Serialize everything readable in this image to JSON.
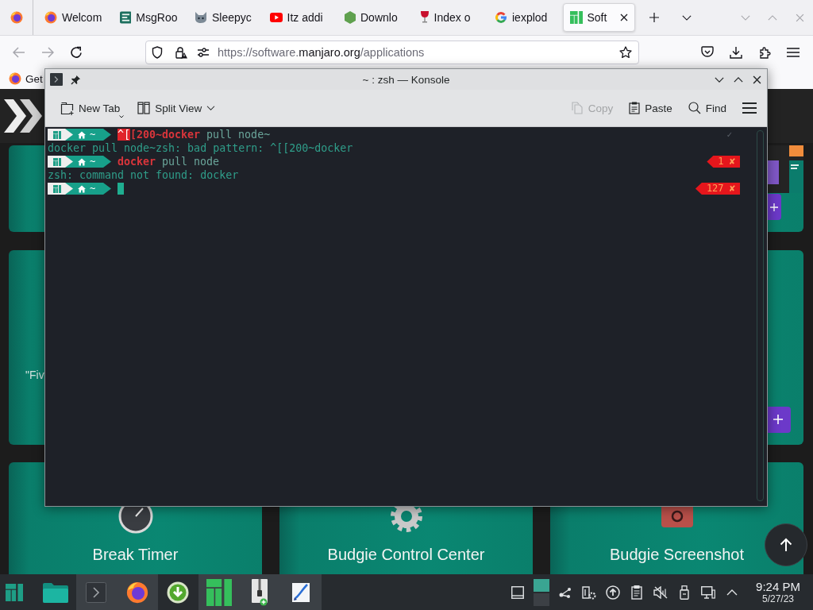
{
  "browser": {
    "tabs": [
      {
        "label": "Welcom",
        "selected": false
      },
      {
        "label": "MsgRoo",
        "selected": false
      },
      {
        "label": "Sleepyc",
        "selected": false
      },
      {
        "label": "Itz addi",
        "selected": false
      },
      {
        "label": "Downlo",
        "selected": false
      },
      {
        "label": "Index o",
        "selected": false
      },
      {
        "label": "iexplod",
        "selected": false
      },
      {
        "label": "Soft",
        "selected": true
      }
    ],
    "nav_buttons": [
      {
        "disabled": true
      },
      {
        "disabled": true
      },
      {
        "disabled": false
      }
    ],
    "url": {
      "prefix": "https://software.",
      "domain": "manjaro.org",
      "path": "/applications"
    },
    "bookmarks": [
      {
        "label": "Get"
      }
    ]
  },
  "page": {
    "partial_text": "\"Fiv",
    "cards": [
      {
        "title": "Break Timer"
      },
      {
        "title": "Budgie Control Center"
      },
      {
        "title": "Budgie Screenshot"
      }
    ]
  },
  "konsole": {
    "title": "~ : zsh — Konsole",
    "left_actions": [
      {
        "label": "New Tab",
        "disabled": false
      },
      {
        "label": "Split View",
        "disabled": false
      }
    ],
    "right_actions": [
      {
        "label": "Copy",
        "disabled": true
      },
      {
        "label": "Paste",
        "disabled": false
      },
      {
        "label": "Find",
        "disabled": false
      }
    ],
    "lines": [
      {
        "kind": "prompt",
        "dir": "~",
        "cursor": false,
        "segments": [
          {
            "kind": "highlight",
            "text": "^["
          },
          {
            "kind": "error",
            "text": "[200~docker"
          },
          {
            "kind": "plain",
            "text": " pull node~"
          }
        ],
        "status": {
          "kind": "ok",
          "text": "✓"
        }
      },
      {
        "kind": "output",
        "text": "docker pull node~zsh: bad pattern: ^[[200~docker"
      },
      {
        "kind": "prompt",
        "dir": "~",
        "cursor": false,
        "segments": [
          {
            "kind": "error",
            "text": "docker"
          },
          {
            "kind": "plain",
            "text": " pull node"
          }
        ],
        "status": {
          "kind": "error",
          "text": "1 ✘"
        }
      },
      {
        "kind": "output",
        "text": "zsh: command not found: docker"
      },
      {
        "kind": "prompt",
        "dir": "~",
        "cursor": true,
        "status": {
          "kind": "error",
          "text": "127 ✘"
        }
      }
    ]
  },
  "taskbar": {
    "tasks": [
      {
        "running": false
      },
      {
        "running": true
      },
      {
        "running": true
      },
      {
        "running": false
      },
      {
        "running": true
      },
      {
        "running": true
      },
      {
        "running": true
      }
    ],
    "clock": {
      "time": "9:24 PM",
      "date": "5/27/23"
    }
  }
}
